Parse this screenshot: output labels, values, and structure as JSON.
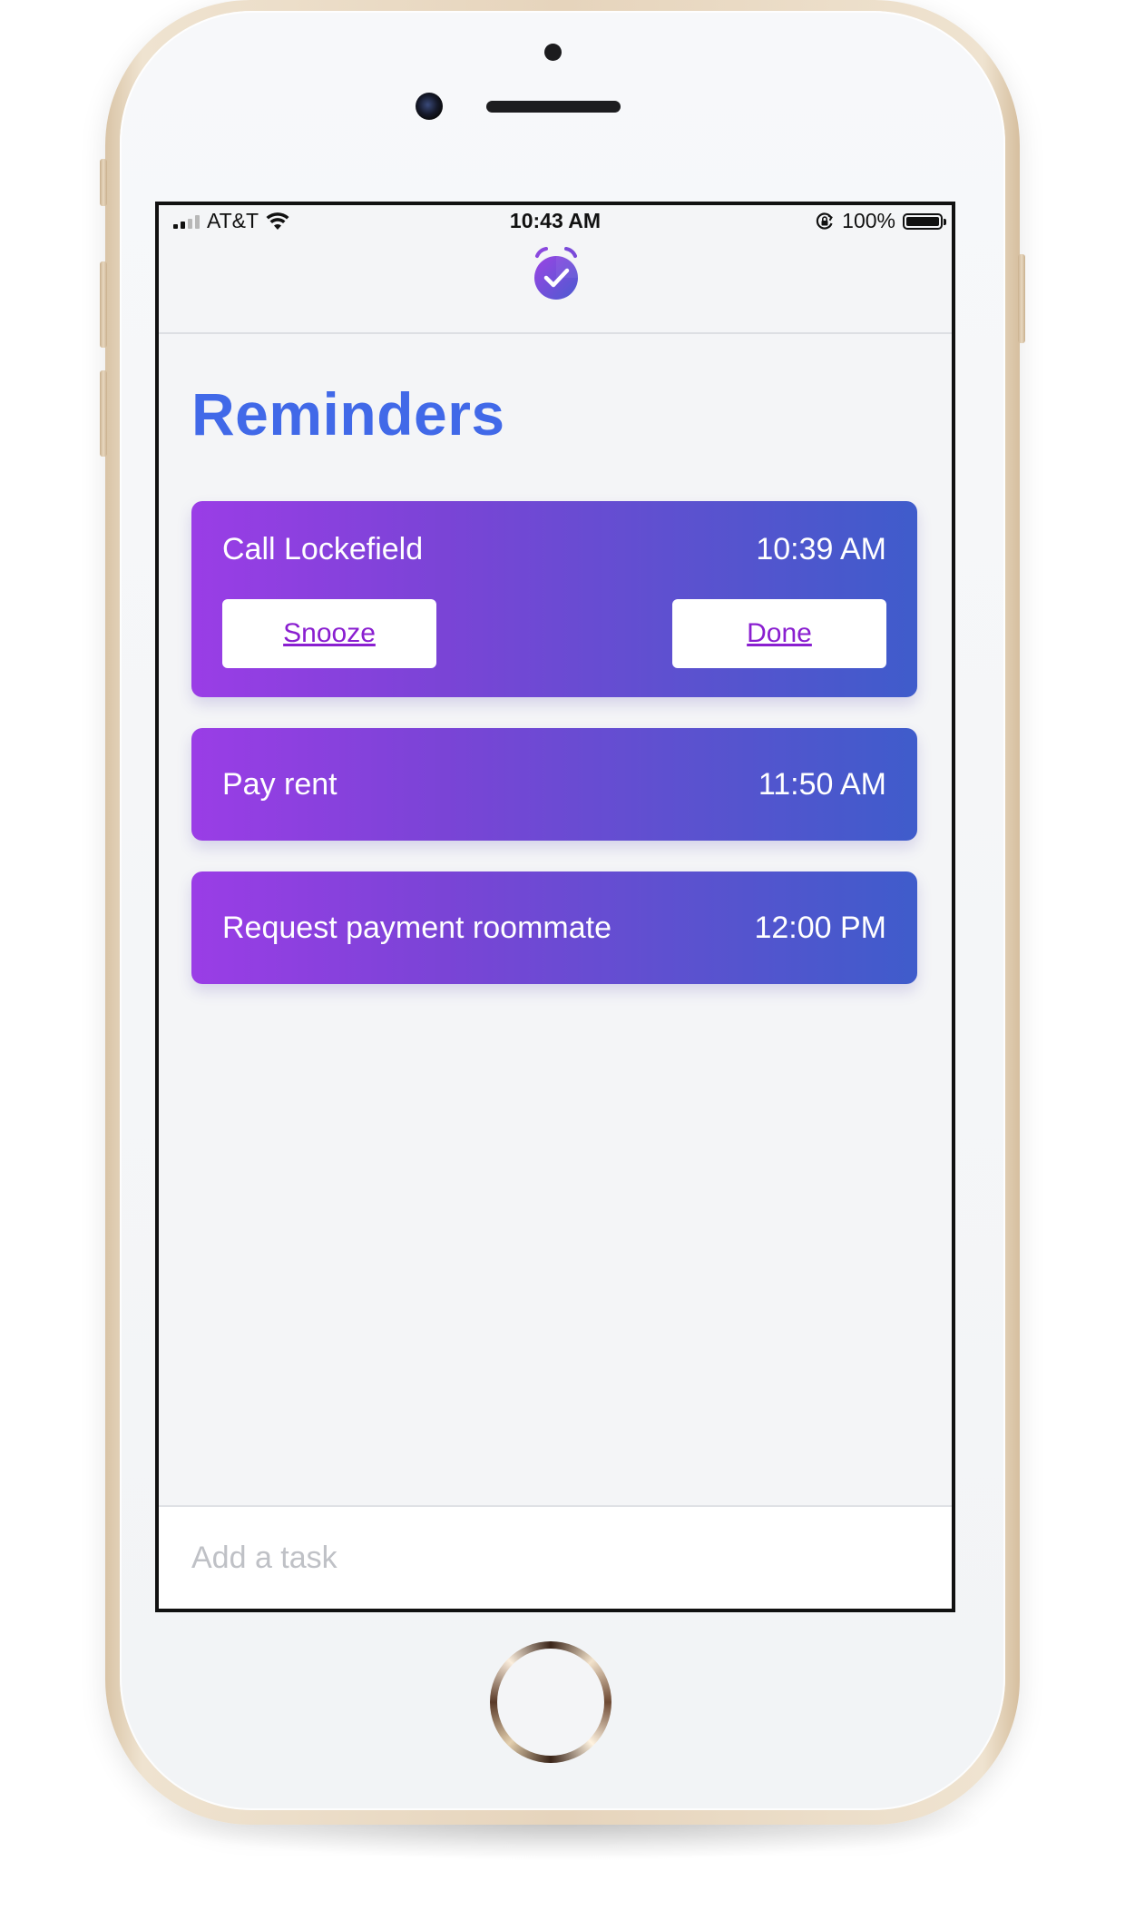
{
  "status_bar": {
    "carrier": "AT&T",
    "time": "10:43 AM",
    "battery_percent": "100%",
    "battery_level": 1.0,
    "signal_bars_filled": 2,
    "icons": [
      "signal-icon",
      "wifi-icon",
      "orientation-lock-icon",
      "battery-icon"
    ]
  },
  "app": {
    "logo_icon": "alarm-clock-check-icon",
    "title": "Reminders",
    "accent_color": "#4169e8",
    "card_gradient": [
      "#9a3de6",
      "#3f5ccb"
    ]
  },
  "reminders": [
    {
      "title": "Call Lockefield",
      "time": "10:39 AM",
      "expanded": true,
      "actions": {
        "snooze_label": "Snooze",
        "done_label": "Done"
      }
    },
    {
      "title": "Pay rent",
      "time": "11:50 AM",
      "expanded": false
    },
    {
      "title": "Request payment roommate",
      "time": "12:00 PM",
      "expanded": false
    }
  ],
  "add_task": {
    "placeholder": "Add a task",
    "value": ""
  }
}
